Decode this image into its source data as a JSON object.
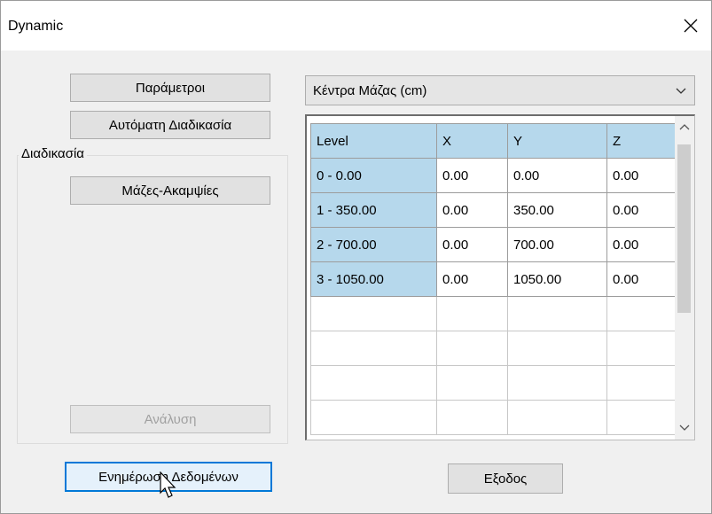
{
  "window": {
    "title": "Dynamic"
  },
  "buttons": {
    "parameters": "Παράμετροι",
    "auto_procedure": "Αυτόματη Διαδικασία",
    "masses_stiffness": "Μάζες-Ακαμψίες",
    "analysis": "Ανάλυση",
    "update_data": "Ενημέρωση Δεδομένων",
    "exit": "Εξοδος"
  },
  "group": {
    "label": "Διαδικασία"
  },
  "combo": {
    "selected": "Κέντρα Μάζας (cm)"
  },
  "grid": {
    "headers": [
      "Level",
      "X",
      "Y",
      "Z"
    ],
    "rows": [
      [
        "0 - 0.00",
        "0.00",
        "0.00",
        "0.00"
      ],
      [
        "1 - 350.00",
        "0.00",
        "350.00",
        "0.00"
      ],
      [
        "2 - 700.00",
        "0.00",
        "700.00",
        "0.00"
      ],
      [
        "3 - 1050.00",
        "0.00",
        "1050.00",
        "0.00"
      ]
    ]
  },
  "icons": [
    "close-icon",
    "chevron-down-icon",
    "scroll-up-icon",
    "scroll-down-icon",
    "mouse-pointer-icon"
  ]
}
